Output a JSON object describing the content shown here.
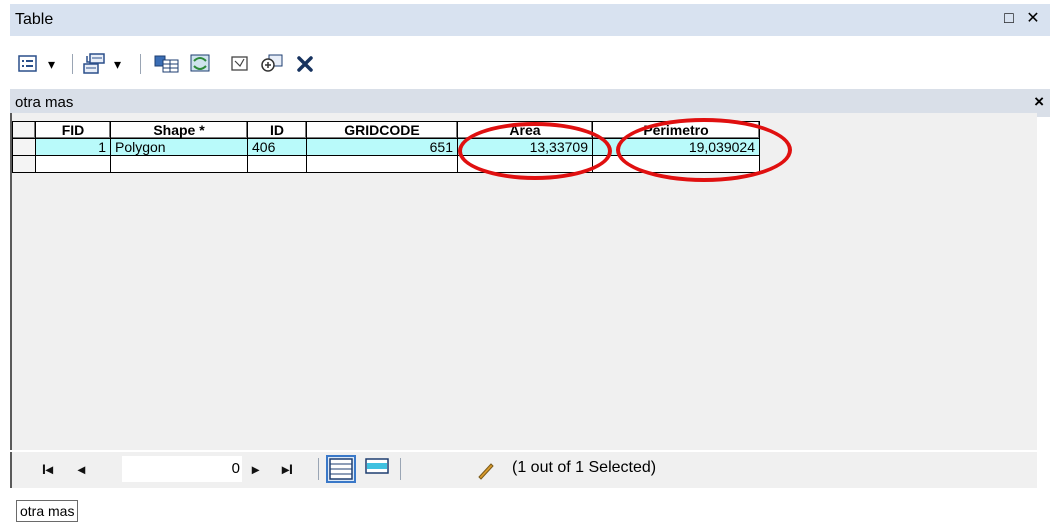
{
  "window": {
    "title": "Table",
    "restore_label": "□",
    "close_label": "✕"
  },
  "toolbar": {
    "icons": [
      "table-options-icon",
      "related-tables-icon",
      "select-by-attributes-icon",
      "switch-selection-icon",
      "clear-selection-icon",
      "zoom-to-selected-icon",
      "delete-selected-icon"
    ],
    "dropdown_label": "▾"
  },
  "tab": {
    "name": "otra mas",
    "close_label": "×"
  },
  "table": {
    "columns": [
      "FID",
      "Shape *",
      "ID",
      "GRIDCODE",
      "Area",
      "Perimetro"
    ],
    "rows": [
      [
        "1",
        "Polygon",
        "406",
        "651",
        "13,33709",
        "19,039024"
      ]
    ]
  },
  "annotation": {
    "color": "#e01010",
    "highlighted_columns": [
      "Area",
      "Perimetro"
    ]
  },
  "footer": {
    "first_label": "I◂",
    "prev_label": "◂",
    "record_value": "0",
    "next_label": "▸",
    "last_label": "▸I",
    "status": "(1 out of 1 Selected)"
  },
  "bottom_tab": {
    "label": "otra mas"
  },
  "colors": {
    "selected_row": "#b9fafa",
    "titlebar": "#d8e2f0",
    "tabbar": "#d9dfe8"
  }
}
